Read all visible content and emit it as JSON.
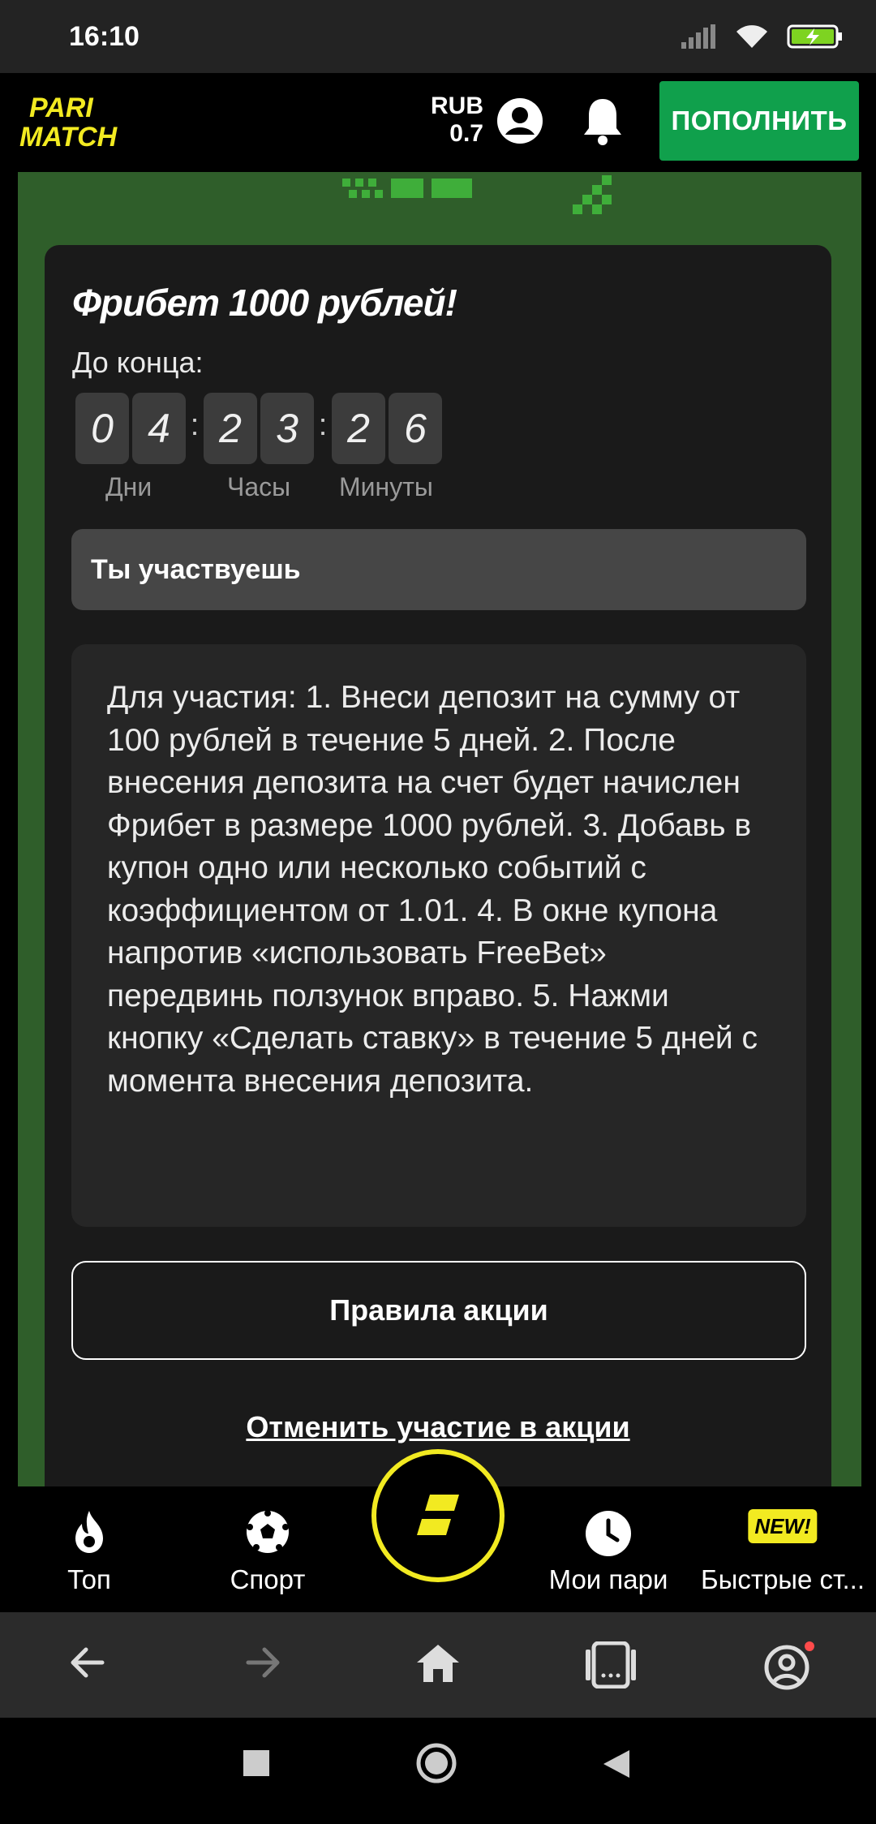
{
  "status_bar": {
    "time": "16:10"
  },
  "header": {
    "logo_top": "PARI",
    "logo_bottom": "MATCH",
    "currency": "RUB",
    "balance": "0.7",
    "topup_label": "ПОПОЛНИТЬ"
  },
  "promo": {
    "title": "Фрибет 1000 рублей!",
    "until_label": "До конца:",
    "countdown": {
      "days": [
        "0",
        "4"
      ],
      "hours": [
        "2",
        "3"
      ],
      "minutes": [
        "2",
        "6"
      ],
      "days_label": "Дни",
      "hours_label": "Часы",
      "minutes_label": "Минуты"
    },
    "status": "Ты участвуешь",
    "description": "Для участия: 1. Внеси депозит на сумму от 100 рублей в течение 5 дней. 2. После внесения депозита на счет будет начислен Фрибет в размере 1000 рублей. 3. Добавь в купон одно или несколько событий с коэффициентом от 1.01. 4. В окне купона напротив  «использовать FreeBet» передвинь ползунок вправо. 5. Нажми кнопку «Сделать ставку» в течение 5 дней с момента внесения депозита.",
    "rules_button": "Правила акции",
    "cancel_link": "Отменить участие в акции"
  },
  "bottom_nav": {
    "top": "Топ",
    "sport": "Спорт",
    "my_bets": "Мои пари",
    "fast_bets": "Быстрые ст...",
    "new_badge": "NEW!"
  },
  "colors": {
    "brand_yellow": "#f2ea21",
    "topup_green": "#10a04c",
    "frame_green": "#2f5e2a",
    "card_bg": "#1a1a1a"
  }
}
